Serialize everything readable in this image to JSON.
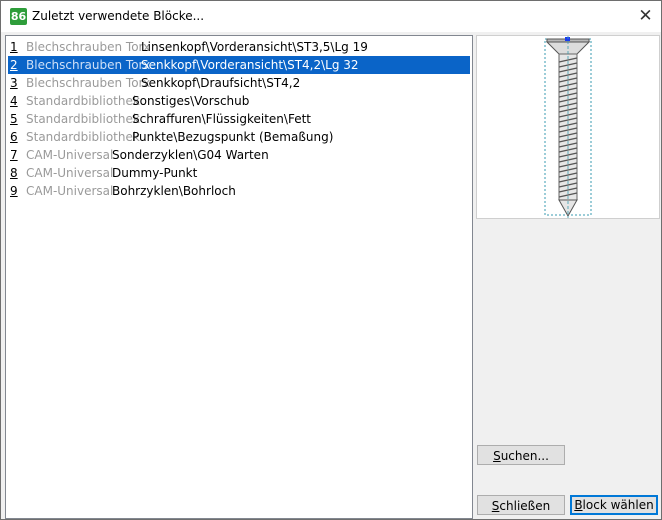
{
  "window": {
    "title": "Zuletzt verwendete Blöcke...",
    "app_icon_text": "86",
    "close_glyph": "✕"
  },
  "list": {
    "items": [
      {
        "num": "1",
        "lib": "Blechschrauben Torx",
        "name": "Linsenkopf\\Vorderansicht\\ST3,5\\Lg 19",
        "selected": false
      },
      {
        "num": "2",
        "lib": "Blechschrauben Torx",
        "name": "Senkkopf\\Vorderansicht\\ST4,2\\Lg 32",
        "selected": true
      },
      {
        "num": "3",
        "lib": "Blechschrauben Torx",
        "name": "Senkkopf\\Draufsicht\\ST4,2",
        "selected": false
      },
      {
        "num": "4",
        "lib": "Standardbibliothek",
        "name": "Sonstiges\\Vorschub",
        "selected": false
      },
      {
        "num": "5",
        "lib": "Standardbibliothek",
        "name": "Schraffuren\\Flüssigkeiten\\Fett",
        "selected": false
      },
      {
        "num": "6",
        "lib": "Standardbibliothek",
        "name": "Punkte\\Bezugspunkt (Bemaßung)",
        "selected": false
      },
      {
        "num": "7",
        "lib": "CAM-Universal",
        "name": "Sonderzyklen\\G04 Warten",
        "selected": false
      },
      {
        "num": "8",
        "lib": "CAM-Universal",
        "name": "Dummy-Punkt",
        "selected": false
      },
      {
        "num": "9",
        "lib": "CAM-Universal",
        "name": "Bohrzyklen\\Bohrloch",
        "selected": false
      }
    ]
  },
  "buttons": {
    "search_accel": "S",
    "search_rest": "uchen...",
    "close_accel": "S",
    "close_rest": "chließen",
    "choose_accel": "B",
    "choose_rest": "lock wählen"
  },
  "colors": {
    "selection": "#0a64c8",
    "library_text": "#9a9a9a",
    "app_icon": "#2e9d3a",
    "preview_outline": "#3a9bb0"
  }
}
